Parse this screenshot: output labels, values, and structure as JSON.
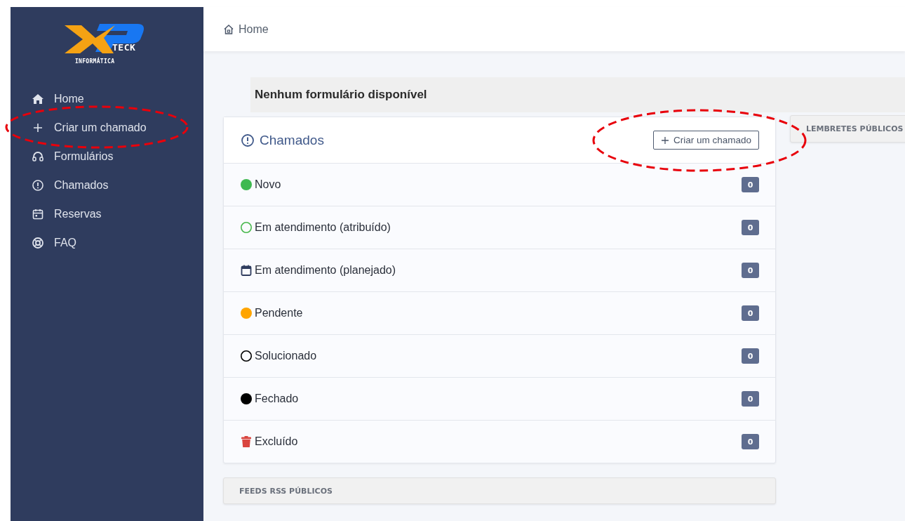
{
  "logo": {
    "text": "TECK",
    "subtext": "INFORMÁTICA"
  },
  "sidebar": {
    "items": [
      {
        "label": "Home",
        "kind": "home",
        "highlighted": false
      },
      {
        "label": "Criar um chamado",
        "kind": "plus",
        "highlighted": true
      },
      {
        "label": "Formulários",
        "kind": "headset",
        "highlighted": false
      },
      {
        "label": "Chamados",
        "kind": "alert",
        "highlighted": false
      },
      {
        "label": "Reservas",
        "kind": "calendar",
        "highlighted": false
      },
      {
        "label": "FAQ",
        "kind": "lifebuoy",
        "highlighted": false
      }
    ]
  },
  "breadcrumb": "Home",
  "forms_notice": "Nenhum formulário disponível",
  "tickets_card": {
    "title": "Chamados",
    "create_button": {
      "label": "Criar um chamado",
      "highlighted": true
    },
    "rows": [
      {
        "label": "Novo",
        "kind": "dot",
        "color": "#3fb950",
        "count": "0"
      },
      {
        "label": "Em atendimento (atribuído)",
        "kind": "ring",
        "color": "#49b84d",
        "count": "0"
      },
      {
        "label": "Em atendimento (planejado)",
        "kind": "calendar",
        "color": "#2f3c5e",
        "count": "0"
      },
      {
        "label": "Pendente",
        "kind": "dot",
        "color": "#ffa500",
        "count": "0"
      },
      {
        "label": "Solucionado",
        "kind": "ring",
        "color": "#000000",
        "count": "0"
      },
      {
        "label": "Fechado",
        "kind": "dot",
        "color": "#000000",
        "count": "0"
      },
      {
        "label": "Excluído",
        "kind": "trash",
        "color": "#d9453f",
        "count": "0"
      }
    ]
  },
  "rss_panel": {
    "title": "FEEDS RSS PÚBLICOS"
  },
  "reminders_panel": {
    "title": "LEMBRETES PÚBLICOS"
  }
}
